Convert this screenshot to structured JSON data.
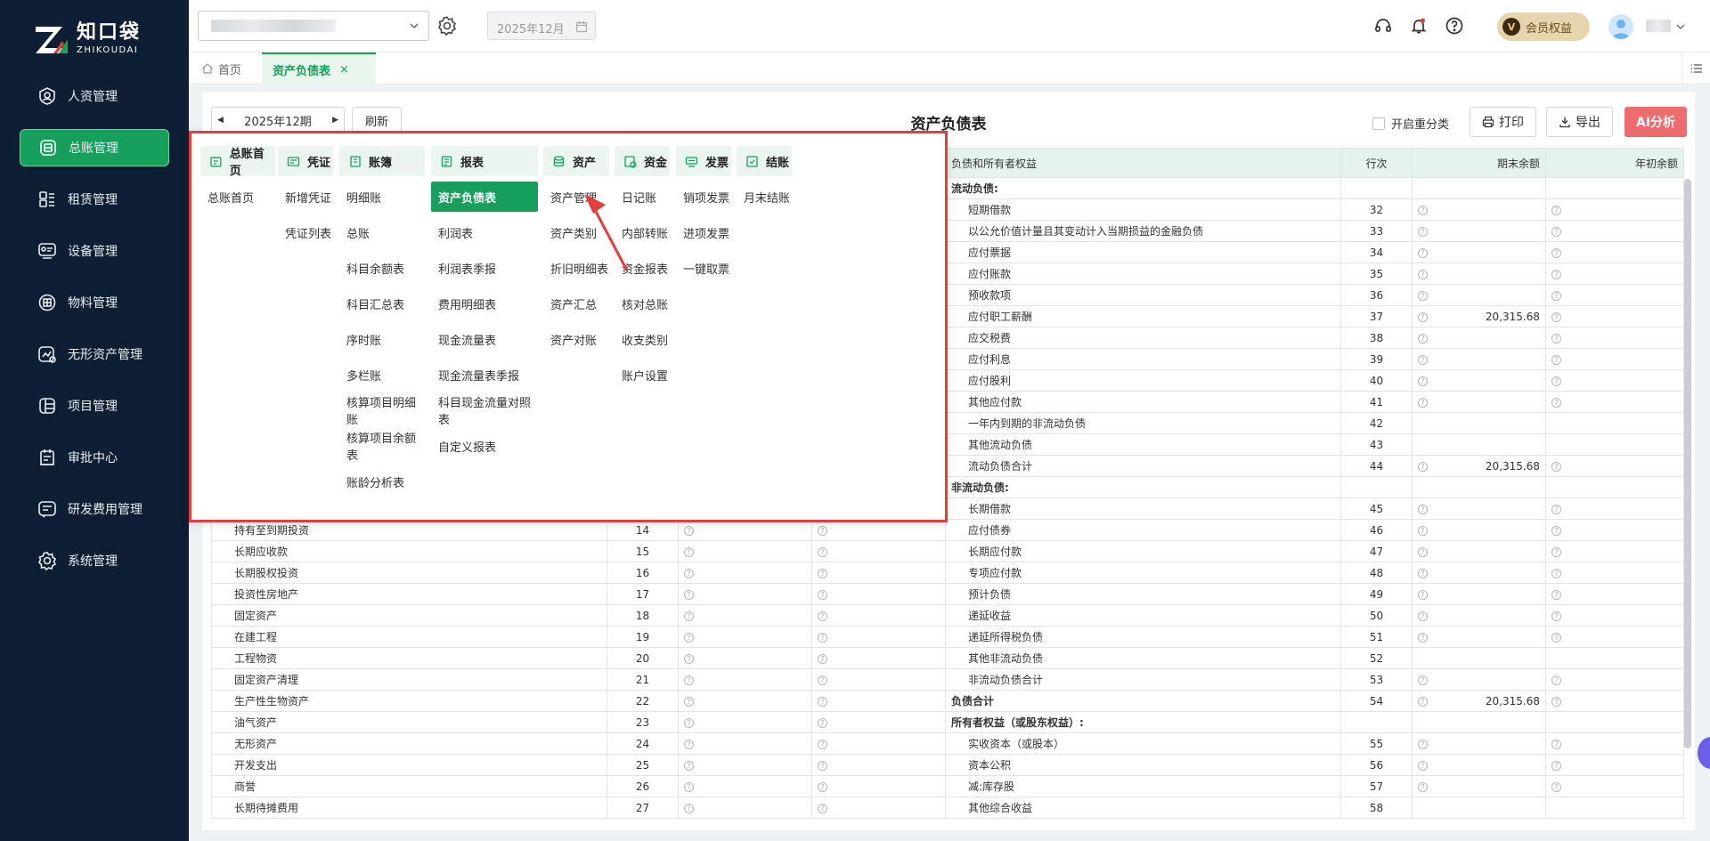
{
  "app": {
    "logo_cn": "知口袋",
    "logo_en": "ZHIKOUDAI",
    "brand_color": "#17a05d",
    "sidebar_bg": "#0f1f33"
  },
  "sidebar": {
    "items": [
      {
        "label": "人资管理",
        "icon": "user-icon",
        "active": false
      },
      {
        "label": "总账管理",
        "icon": "ledger-icon",
        "active": true
      },
      {
        "label": "租赁管理",
        "icon": "lease-icon",
        "active": false
      },
      {
        "label": "设备管理",
        "icon": "device-icon",
        "active": false
      },
      {
        "label": "物料管理",
        "icon": "box-icon",
        "active": false
      },
      {
        "label": "无形资产管理",
        "icon": "intangible-icon",
        "active": false
      },
      {
        "label": "项目管理",
        "icon": "project-icon",
        "active": false
      },
      {
        "label": "审批中心",
        "icon": "approval-icon",
        "active": false
      },
      {
        "label": "研发费用管理",
        "icon": "rd-icon",
        "active": false
      },
      {
        "label": "系统管理",
        "icon": "gear-icon",
        "active": false
      }
    ]
  },
  "header": {
    "date_value": "2025年12月",
    "vip_label": "会员权益",
    "vip_badge": "V"
  },
  "tabs": {
    "home": "首页",
    "active": "资产负债表"
  },
  "toolbar": {
    "period": "2025年12期",
    "refresh": "刷新",
    "title": "资产负债表",
    "reclass": "开启重分类",
    "print": "打印",
    "export": "导出",
    "ai": "AI分析"
  },
  "table": {
    "headers": {
      "liab": "负债和所有者权益",
      "line": "行次",
      "end": "期末余额",
      "begin": "年初余额"
    },
    "left_rows": [
      {
        "name": "持有至到期投资",
        "line": "14"
      },
      {
        "name": "长期应收款",
        "line": "15"
      },
      {
        "name": "长期股权投资",
        "line": "16"
      },
      {
        "name": "投资性房地产",
        "line": "17"
      },
      {
        "name": "固定资产",
        "line": "18"
      },
      {
        "name": "在建工程",
        "line": "19"
      },
      {
        "name": "工程物资",
        "line": "20"
      },
      {
        "name": "固定资产清理",
        "line": "21"
      },
      {
        "name": "生产性生物资产",
        "line": "22"
      },
      {
        "name": "油气资产",
        "line": "23"
      },
      {
        "name": "无形资产",
        "line": "24"
      },
      {
        "name": "开发支出",
        "line": "25"
      },
      {
        "name": "商誉",
        "line": "26"
      },
      {
        "name": "长期待摊费用",
        "line": "27"
      }
    ],
    "right_rows": [
      {
        "name": "流动负债:",
        "line": "",
        "end": "",
        "sec": true,
        "q": false
      },
      {
        "name": "短期借款",
        "line": "32",
        "end": "",
        "q": true
      },
      {
        "name": "以公允价值计量且其变动计入当期损益的金融负债",
        "line": "33",
        "end": "",
        "q": true
      },
      {
        "name": "应付票据",
        "line": "34",
        "end": "",
        "q": true
      },
      {
        "name": "应付账款",
        "line": "35",
        "end": "",
        "q": true
      },
      {
        "name": "预收款项",
        "line": "36",
        "end": "",
        "q": true
      },
      {
        "name": "应付职工薪酬",
        "line": "37",
        "end": "20,315.68",
        "q": true
      },
      {
        "name": "应交税费",
        "line": "38",
        "end": "",
        "q": true
      },
      {
        "name": "应付利息",
        "line": "39",
        "end": "",
        "q": true
      },
      {
        "name": "应付股利",
        "line": "40",
        "end": "",
        "q": true
      },
      {
        "name": "其他应付款",
        "line": "41",
        "end": "",
        "q": true
      },
      {
        "name": "一年内到期的非流动负债",
        "line": "42",
        "end": "",
        "q": false
      },
      {
        "name": "其他流动负债",
        "line": "43",
        "end": "",
        "q": false
      },
      {
        "name": "流动负债合计",
        "line": "44",
        "end": "20,315.68",
        "q": true
      },
      {
        "name": "非流动负债:",
        "line": "",
        "end": "",
        "sec": true,
        "q": false
      },
      {
        "name": "长期借款",
        "line": "45",
        "end": "",
        "q": true
      },
      {
        "name": "应付债券",
        "line": "46",
        "end": "",
        "q": true
      },
      {
        "name": "长期应付款",
        "line": "47",
        "end": "",
        "q": true
      },
      {
        "name": "专项应付款",
        "line": "48",
        "end": "",
        "q": true
      },
      {
        "name": "预计负债",
        "line": "49",
        "end": "",
        "q": true
      },
      {
        "name": "递延收益",
        "line": "50",
        "end": "",
        "q": true
      },
      {
        "name": "递延所得税负债",
        "line": "51",
        "end": "",
        "q": true
      },
      {
        "name": "其他非流动负债",
        "line": "52",
        "end": "",
        "q": false
      },
      {
        "name": "非流动负债合计",
        "line": "53",
        "end": "",
        "q": true
      },
      {
        "name": "负债合计",
        "line": "54",
        "end": "20,315.68",
        "sec": true,
        "q": true
      },
      {
        "name": "所有者权益（或股东权益）:",
        "line": "",
        "end": "",
        "sec": true,
        "q": false
      },
      {
        "name": "实收资本（或股本）",
        "line": "55",
        "end": "",
        "q": true
      },
      {
        "name": "资本公积",
        "line": "56",
        "end": "",
        "q": true
      },
      {
        "name": "减:库存股",
        "line": "57",
        "end": "",
        "q": true
      },
      {
        "name": "其他综合收益",
        "line": "58",
        "end": "",
        "q": false
      }
    ]
  },
  "menu": {
    "columns": [
      {
        "title": "总账首页",
        "icon": "home-ledger-icon",
        "items": [
          "总账首页"
        ]
      },
      {
        "title": "凭证",
        "icon": "voucher-icon",
        "items": [
          "新增凭证",
          "凭证列表"
        ]
      },
      {
        "title": "账簿",
        "icon": "book-icon",
        "items": [
          "明细账",
          "总账",
          "科目余额表",
          "科目汇总表",
          "序时账",
          "多栏账",
          "核算项目明细账",
          "核算项目余额表",
          "账龄分析表"
        ]
      },
      {
        "title": "报表",
        "icon": "report-icon",
        "items": [
          "资产负债表",
          "利润表",
          "利润表季报",
          "费用明细表",
          "现金流量表",
          "现金流量表季报",
          "科目现金流量对照表",
          "自定义报表"
        ],
        "active": 0
      },
      {
        "title": "资产",
        "icon": "asset-icon",
        "items": [
          "资产管理",
          "资产类别",
          "折旧明细表",
          "资产汇总",
          "资产对账"
        ]
      },
      {
        "title": "资金",
        "icon": "fund-icon",
        "items": [
          "日记账",
          "内部转账",
          "资金报表",
          "核对总账",
          "收支类别",
          "账户设置"
        ]
      },
      {
        "title": "发票",
        "icon": "invoice-icon",
        "items": [
          "销项发票",
          "进项发票",
          "一键取票"
        ]
      },
      {
        "title": "结账",
        "icon": "close-ledger-icon",
        "items": [
          "月末结账"
        ]
      }
    ]
  }
}
